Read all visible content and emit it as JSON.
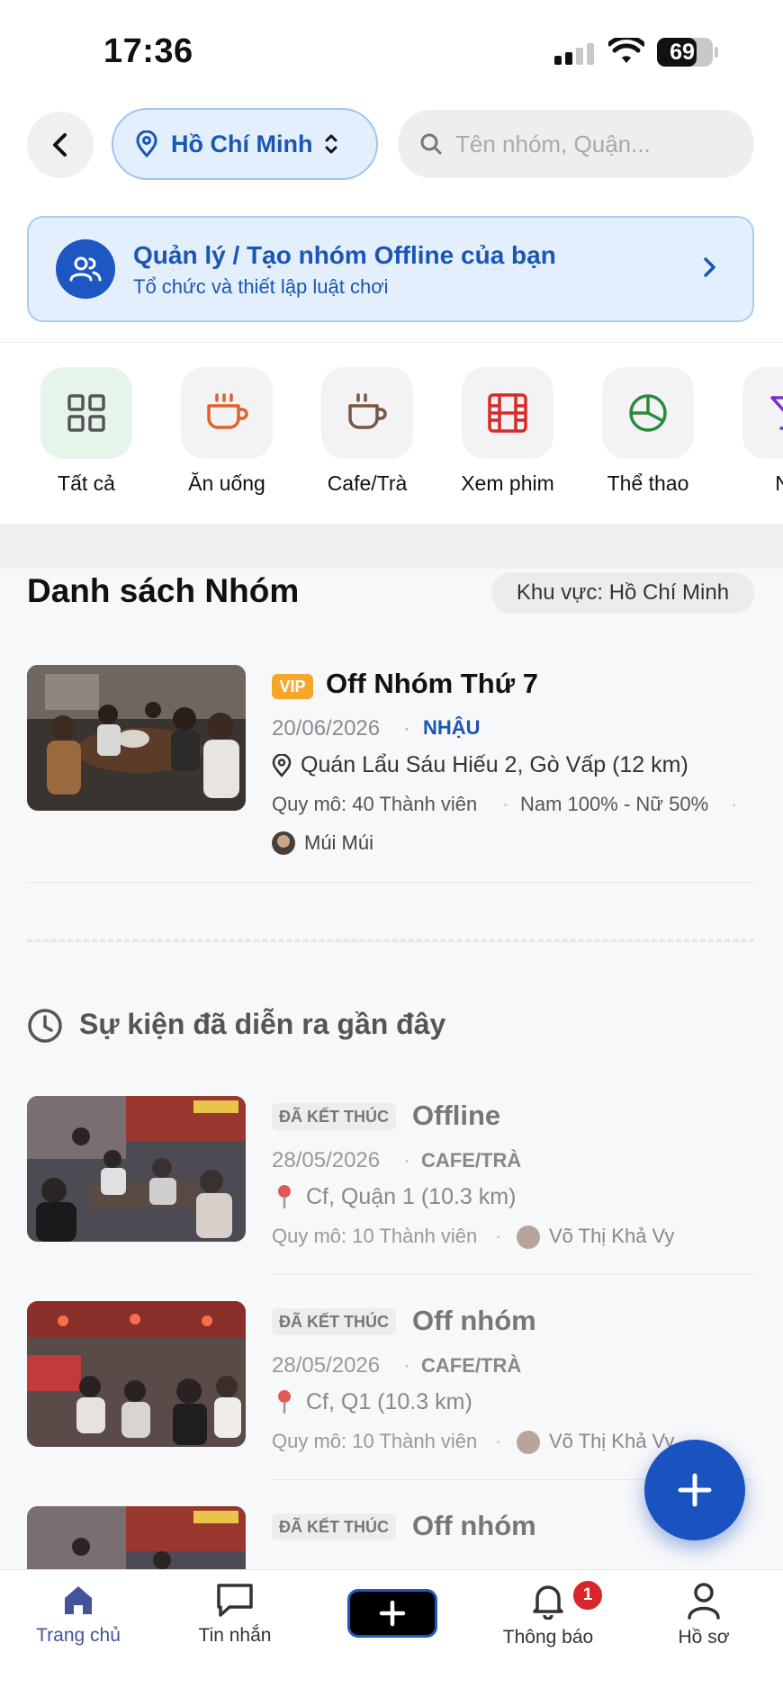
{
  "status_bar": {
    "time": "17:36",
    "battery": "69"
  },
  "header": {
    "location": "Hồ Chí Minh",
    "search_placeholder": "Tên nhóm, Quận..."
  },
  "banner": {
    "title": "Quản lý / Tạo nhóm Offline của bạn",
    "subtitle": "Tổ chức và thiết lập luật chơi"
  },
  "categories": [
    {
      "label": "Tất cả",
      "icon": "grid-icon"
    },
    {
      "label": "Ăn uống",
      "icon": "cup-icon"
    },
    {
      "label": "Cafe/Trà",
      "icon": "coffee-icon"
    },
    {
      "label": "Xem phim",
      "icon": "film-icon"
    },
    {
      "label": "Thể thao",
      "icon": "sport-ball-icon"
    },
    {
      "label": "Nh",
      "icon": "cocktail-icon"
    }
  ],
  "groups_section": {
    "title": "Danh sách Nhóm",
    "area_filter": "Khu vực: Hồ Chí Minh"
  },
  "groups": [
    {
      "badge": "VIP",
      "title": "Off Nhóm Thứ 7",
      "date": "20/06/2026",
      "category": "NHẬU",
      "location": "Quán Lẩu Sáu Hiếu 2, Gò Vấp (12 km)",
      "scale": "Quy mô: 40 Thành viên",
      "ratio": "Nam 100% - Nữ 50%",
      "host": "Múi Múi"
    }
  ],
  "past_section": {
    "title": "Sự kiện đã diễn ra gần đây"
  },
  "past_events": [
    {
      "status": "ĐÃ KẾT THÚC",
      "title": "Offline",
      "date": "28/05/2026",
      "category": "CAFE/TRÀ",
      "location": "Cf, Quận 1 (10.3 km)",
      "scale": "Quy mô: 10 Thành viên",
      "host": "Võ Thị Khả Vy"
    },
    {
      "status": "ĐÃ KẾT THÚC",
      "title": "Off nhóm",
      "date": "28/05/2026",
      "category": "CAFE/TRÀ",
      "location": "Cf, Q1 (10.3 km)",
      "scale": "Quy mô: 10 Thành viên",
      "host": "Võ Thị Khả Vy"
    },
    {
      "status": "ĐÃ KẾT THÚC",
      "title": "Off nhóm"
    }
  ],
  "bottom_nav": {
    "home": "Trang chủ",
    "messages": "Tin nhắn",
    "notifications": "Thông báo",
    "notification_count": "1",
    "profile": "Hồ sơ"
  },
  "colors": {
    "accent": "#1a56b4",
    "vip": "#f6a72a",
    "badge_red": "#d9262a"
  }
}
